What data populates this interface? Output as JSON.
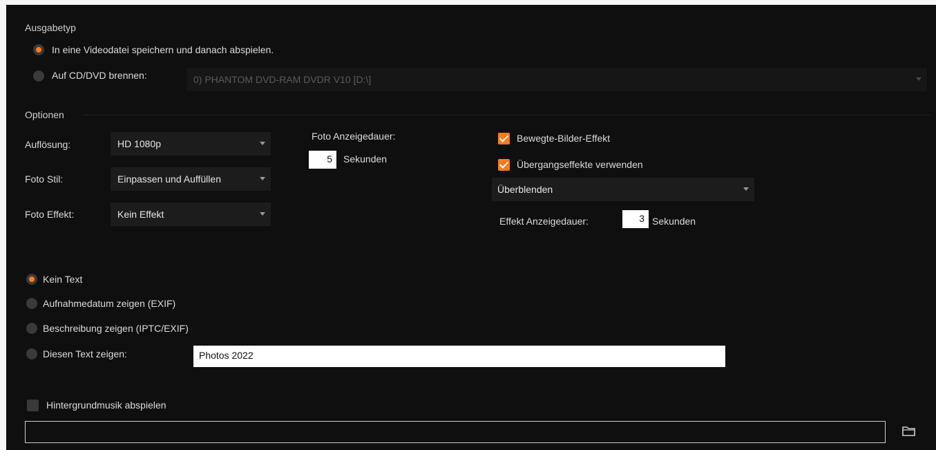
{
  "output_type": {
    "title": "Ausgabetyp",
    "save_video_label": "In eine Videodatei speichern und danach abspielen.",
    "burn_disc_label": "Auf CD/DVD brennen:",
    "drive_value": "0) PHANTOM  DVD-RAM DVDR V10 [D:\\]"
  },
  "options": {
    "title": "Optionen",
    "resolution_label": "Auflösung:",
    "resolution_value": "HD 1080p",
    "photo_style_label": "Foto Stil:",
    "photo_style_value": "Einpassen und Auffüllen",
    "photo_effect_label": "Foto Effekt:",
    "photo_effect_value": "Kein Effekt",
    "photo_duration_label": "Foto Anzeigedauer:",
    "photo_duration_value": "5",
    "photo_duration_unit": "Sekunden",
    "motion_effect_label": "Bewegte-Bilder-Effekt",
    "transition_label": "Übergangseffekte verwenden",
    "transition_value": "Überblenden",
    "effect_duration_label": "Effekt Anzeigedauer:",
    "effect_duration_value": "3",
    "effect_duration_unit": "Sekunden"
  },
  "text_options": {
    "no_text": "Kein Text",
    "show_date": "Aufnahmedatum zeigen (EXIF)",
    "show_description": "Beschreibung zeigen (IPTC/EXIF)",
    "show_custom": "Diesen Text zeigen:",
    "custom_value": "Photos 2022"
  },
  "music": {
    "label": "Hintergrundmusik abspielen",
    "path_value": ""
  },
  "colors": {
    "accent": "#ff7a1a",
    "background": "#0f0f0f"
  }
}
